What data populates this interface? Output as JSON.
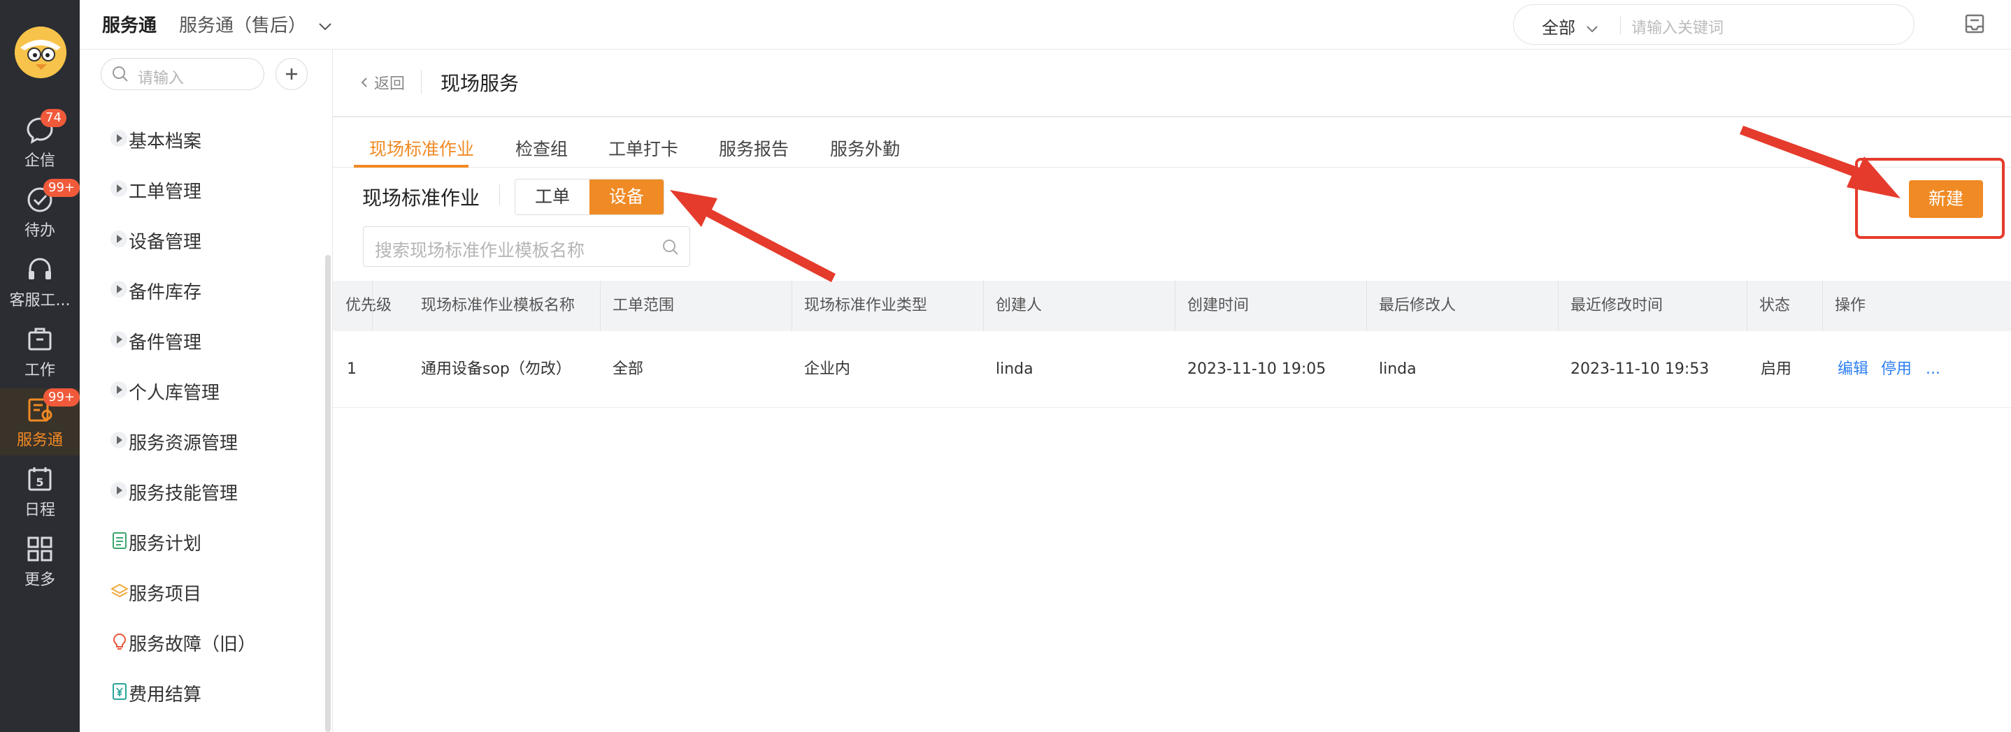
{
  "rail": {
    "items": [
      {
        "label": "企信",
        "badge": "74"
      },
      {
        "label": "待办",
        "badge": "99+"
      },
      {
        "label": "客服工..."
      },
      {
        "label": "工作"
      },
      {
        "label": "服务通",
        "badge": "99+"
      },
      {
        "label": "日程",
        "icon_text": "5"
      },
      {
        "label": "更多"
      }
    ]
  },
  "header": {
    "app_title": "服务通",
    "app_sub": "服务通（售后）",
    "search_scope": "全部",
    "search_placeholder": "请输入关键词"
  },
  "sidebar": {
    "search_placeholder": "请输入",
    "items": [
      {
        "label": "基本档案"
      },
      {
        "label": "工单管理"
      },
      {
        "label": "设备管理"
      },
      {
        "label": "备件库存"
      },
      {
        "label": "备件管理"
      },
      {
        "label": "个人库管理"
      },
      {
        "label": "服务资源管理"
      },
      {
        "label": "服务技能管理"
      },
      {
        "label": "服务计划"
      },
      {
        "label": "服务项目"
      },
      {
        "label": "服务故障（旧）"
      },
      {
        "label": "费用结算"
      }
    ]
  },
  "page": {
    "back_label": "返回",
    "title": "现场服务",
    "tabs": [
      {
        "label": "现场标准作业",
        "active": true
      },
      {
        "label": "检查组"
      },
      {
        "label": "工单打卡"
      },
      {
        "label": "服务报告"
      },
      {
        "label": "服务外勤"
      }
    ],
    "section_title": "现场标准作业",
    "segments": [
      {
        "label": "工单"
      },
      {
        "label": "设备",
        "active": true
      }
    ],
    "list_search_placeholder": "搜索现场标准作业模板名称",
    "new_button": "新建"
  },
  "table": {
    "columns": [
      "优先级",
      "现场标准作业模板名称",
      "工单范围",
      "现场标准作业类型",
      "创建人",
      "创建时间",
      "最后修改人",
      "最近修改时间",
      "状态",
      "操作"
    ],
    "rows": [
      {
        "priority": "1",
        "name": "通用设备sop（勿改）",
        "scope": "全部",
        "type": "企业内",
        "creator": "linda",
        "created": "2023-11-10 19:05",
        "modifier": "linda",
        "modified": "2023-11-10 19:53",
        "status": "启用",
        "actions": [
          "编辑",
          "停用",
          "..."
        ]
      }
    ]
  },
  "colors": {
    "accent": "#f08a24",
    "rail_bg": "#2b2d33",
    "link": "#2f7ff2",
    "annotation_red": "#e53b2c"
  }
}
